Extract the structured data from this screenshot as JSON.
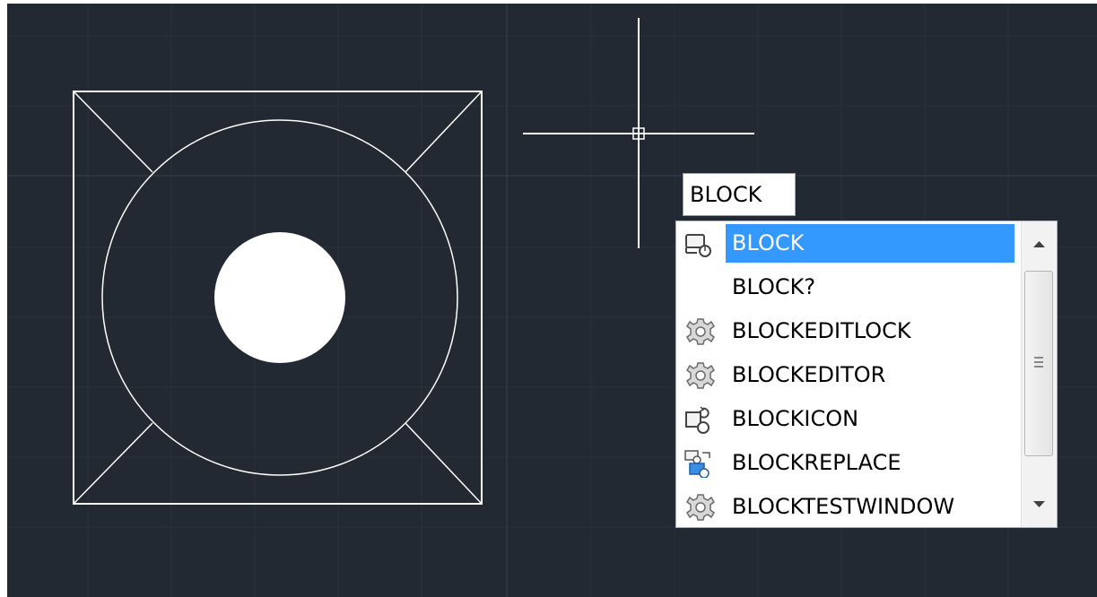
{
  "colors": {
    "canvas_bg": "#222933",
    "grid_minor": "#2a313b",
    "grid_major": "#38404b",
    "drawing_stroke": "#ffffff",
    "selection": "#3399ff"
  },
  "command_input": {
    "value": "BLOCK"
  },
  "autocomplete": {
    "items": [
      {
        "label": "BLOCK",
        "icon": "block-icon",
        "selected": true
      },
      {
        "label": "BLOCK?",
        "icon": "",
        "selected": false
      },
      {
        "label": "BLOCKEDITLOCK",
        "icon": "gear-icon",
        "selected": false
      },
      {
        "label": "BLOCKEDITOR",
        "icon": "gear-icon",
        "selected": false
      },
      {
        "label": "BLOCKICON",
        "icon": "block-icon-refresh",
        "selected": false
      },
      {
        "label": "BLOCKREPLACE",
        "icon": "block-replace-icon",
        "selected": false
      },
      {
        "label": "BLOCKTESTWINDOW",
        "icon": "gear-icon",
        "selected": false
      }
    ]
  }
}
